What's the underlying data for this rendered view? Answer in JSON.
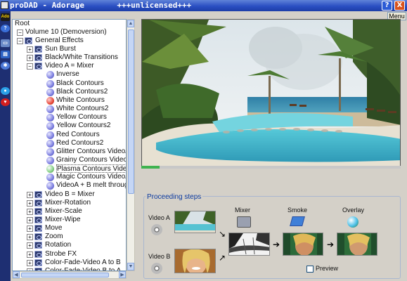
{
  "window": {
    "title": "proDAD - Adorage       +++unlicensed+++",
    "help_label": "?",
    "close_label": "X",
    "menu_label": "Menu"
  },
  "left_toolbar": {
    "icons": [
      "app-logo-icon",
      "help-icon",
      "film-icon",
      "puzzle-icon",
      "settings-icon",
      "globe-icon",
      "heart-icon"
    ]
  },
  "tree": {
    "root": "Root",
    "volume": "Volume 10 (Demoversion)",
    "general_effects": "General Effects",
    "group1": [
      "Sun Burst",
      "Black/White Transitions",
      "Video A = Mixer"
    ],
    "mixer_effects": [
      "Inverse",
      "Black Contours",
      "Black Contours2",
      "White Contours",
      "White Contours2",
      "Yellow Contours",
      "Yellow Contours2",
      "Red Contours",
      "Red Contours2",
      "Glitter Contours VideoA",
      "Grainy Contours VideoA",
      "Plasma Contours VideoA",
      "Magic Contours VideoA",
      "VideoA + B melt through wh"
    ],
    "group2": [
      "Video B = Mixer",
      "Mixer-Rotation",
      "Mixer-Scale",
      "Mixer-Wipe",
      "Move",
      "Zoom",
      "Rotation",
      "Strobe FX",
      "Color-Fade-Video A to B",
      "Color-Fade-Video B to A"
    ],
    "selected": "Plasma Contours VideoA"
  },
  "preview": {
    "progress": 0.07
  },
  "steps": {
    "title": "Proceeding steps",
    "video_a": "Video A",
    "video_b": "Video B",
    "mixer": "Mixer",
    "smoke": "Smoke",
    "overlay": "Overlay",
    "preview_label": "Preview",
    "preview_checked": false
  },
  "colors": {
    "titlebar": "#2a4fc2",
    "accent": "#0b3aa0",
    "progress": "#3fb34f"
  }
}
